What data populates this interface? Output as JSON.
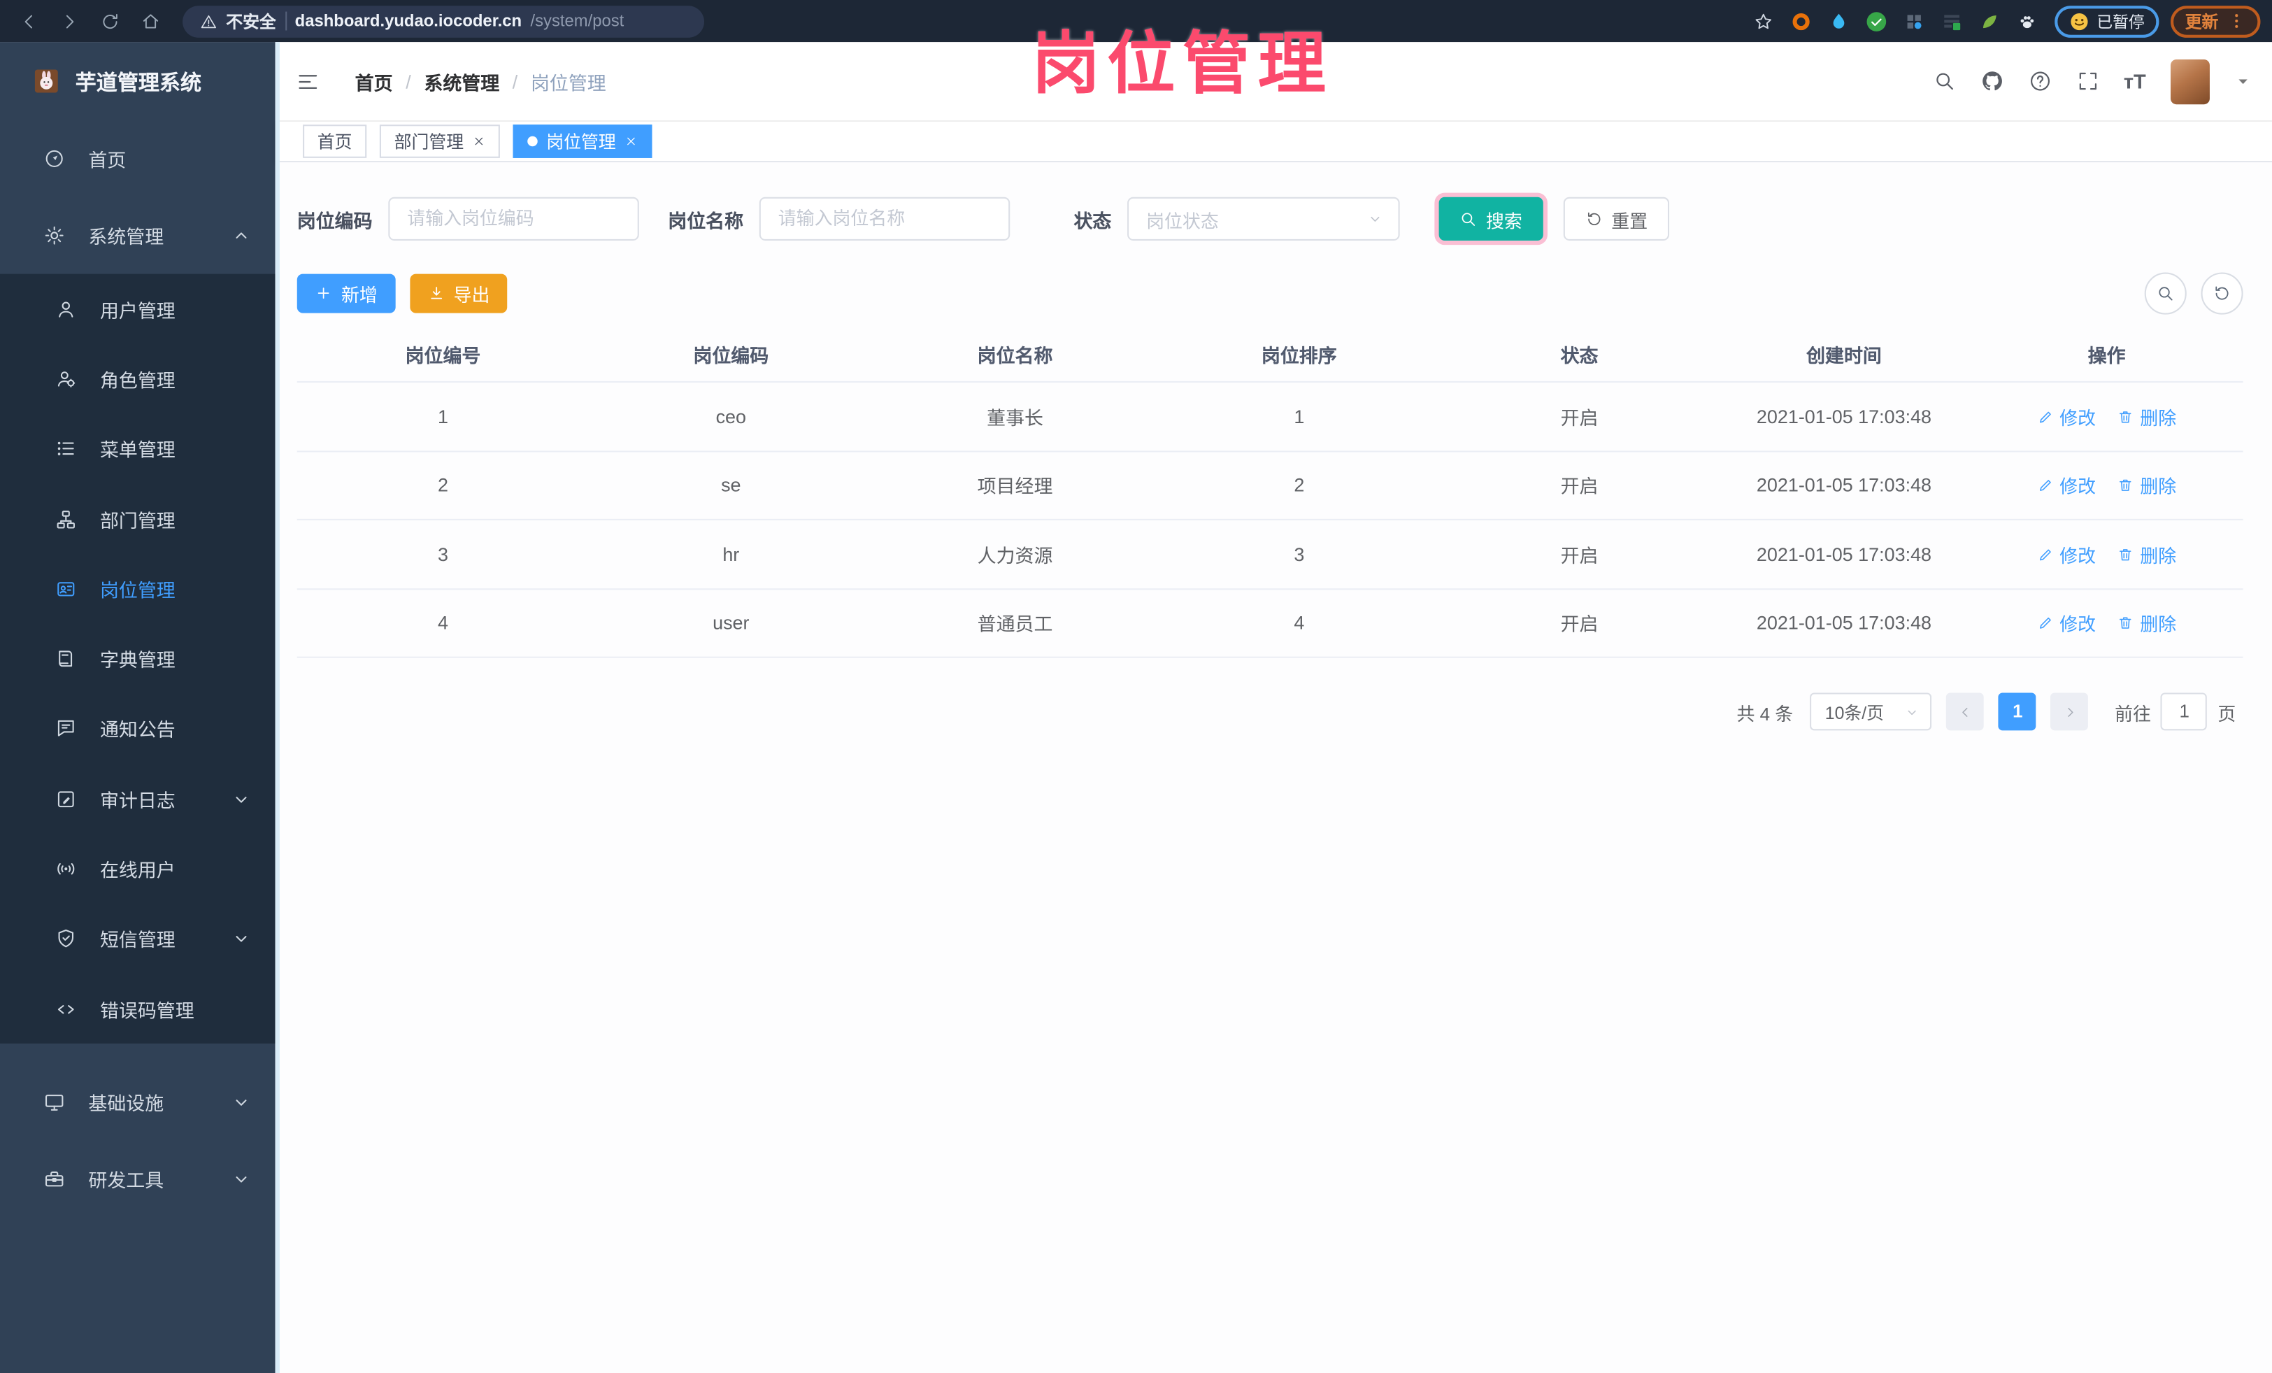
{
  "colors": {
    "accent": "#409EFF",
    "search_teal": "#11B3A2",
    "export_orange": "#F0A11F",
    "overlay_pink": "#FB4A6D",
    "sidebar_bg": "#304156",
    "submenu_bg": "#1F2D3D"
  },
  "browser": {
    "security_label": "不安全",
    "url_host": "dashboard.yudao.iocoder.cn",
    "url_path": "/system/post",
    "paused_label": "已暂停",
    "update_label": "更新"
  },
  "overlay": {
    "title": "岗位管理"
  },
  "sidebar": {
    "app_title": "芋道管理系统",
    "items": [
      {
        "label": "首页"
      },
      {
        "label": "系统管理",
        "expanded": true,
        "children": [
          {
            "label": "用户管理"
          },
          {
            "label": "角色管理"
          },
          {
            "label": "菜单管理"
          },
          {
            "label": "部门管理"
          },
          {
            "label": "岗位管理",
            "active": true
          },
          {
            "label": "字典管理"
          },
          {
            "label": "通知公告"
          },
          {
            "label": "审计日志"
          },
          {
            "label": "在线用户"
          },
          {
            "label": "短信管理"
          },
          {
            "label": "错误码管理"
          }
        ]
      },
      {
        "label": "基础设施"
      },
      {
        "label": "研发工具"
      }
    ]
  },
  "navbar": {
    "breadcrumb": [
      "首页",
      "系统管理",
      "岗位管理"
    ],
    "separator": "/",
    "font_size_icon_label": "тT"
  },
  "tabs": [
    {
      "label": "首页"
    },
    {
      "label": "部门管理"
    },
    {
      "label": "岗位管理",
      "active": true
    }
  ],
  "filters": {
    "post_code_label": "岗位编码",
    "post_code_placeholder": "请输入岗位编码",
    "post_name_label": "岗位名称",
    "post_name_placeholder": "请输入岗位名称",
    "status_label": "状态",
    "status_placeholder": "岗位状态",
    "search_label": "搜索",
    "reset_label": "重置"
  },
  "toolbar": {
    "add_label": "新增",
    "export_label": "导出"
  },
  "table": {
    "columns": [
      "岗位编号",
      "岗位编码",
      "岗位名称",
      "岗位排序",
      "状态",
      "创建时间",
      "操作"
    ],
    "edit_label": "修改",
    "delete_label": "删除",
    "rows": [
      {
        "id": "1",
        "code": "ceo",
        "name": "董事长",
        "sort": "1",
        "status": "开启",
        "created": "2021-01-05 17:03:48"
      },
      {
        "id": "2",
        "code": "se",
        "name": "项目经理",
        "sort": "2",
        "status": "开启",
        "created": "2021-01-05 17:03:48"
      },
      {
        "id": "3",
        "code": "hr",
        "name": "人力资源",
        "sort": "3",
        "status": "开启",
        "created": "2021-01-05 17:03:48"
      },
      {
        "id": "4",
        "code": "user",
        "name": "普通员工",
        "sort": "4",
        "status": "开启",
        "created": "2021-01-05 17:03:48"
      }
    ]
  },
  "pagination": {
    "total_label": "共 4 条",
    "page_size_label": "10条/页",
    "current_page": "1",
    "goto_label": "前往",
    "goto_value": "1",
    "page_unit": "页"
  }
}
